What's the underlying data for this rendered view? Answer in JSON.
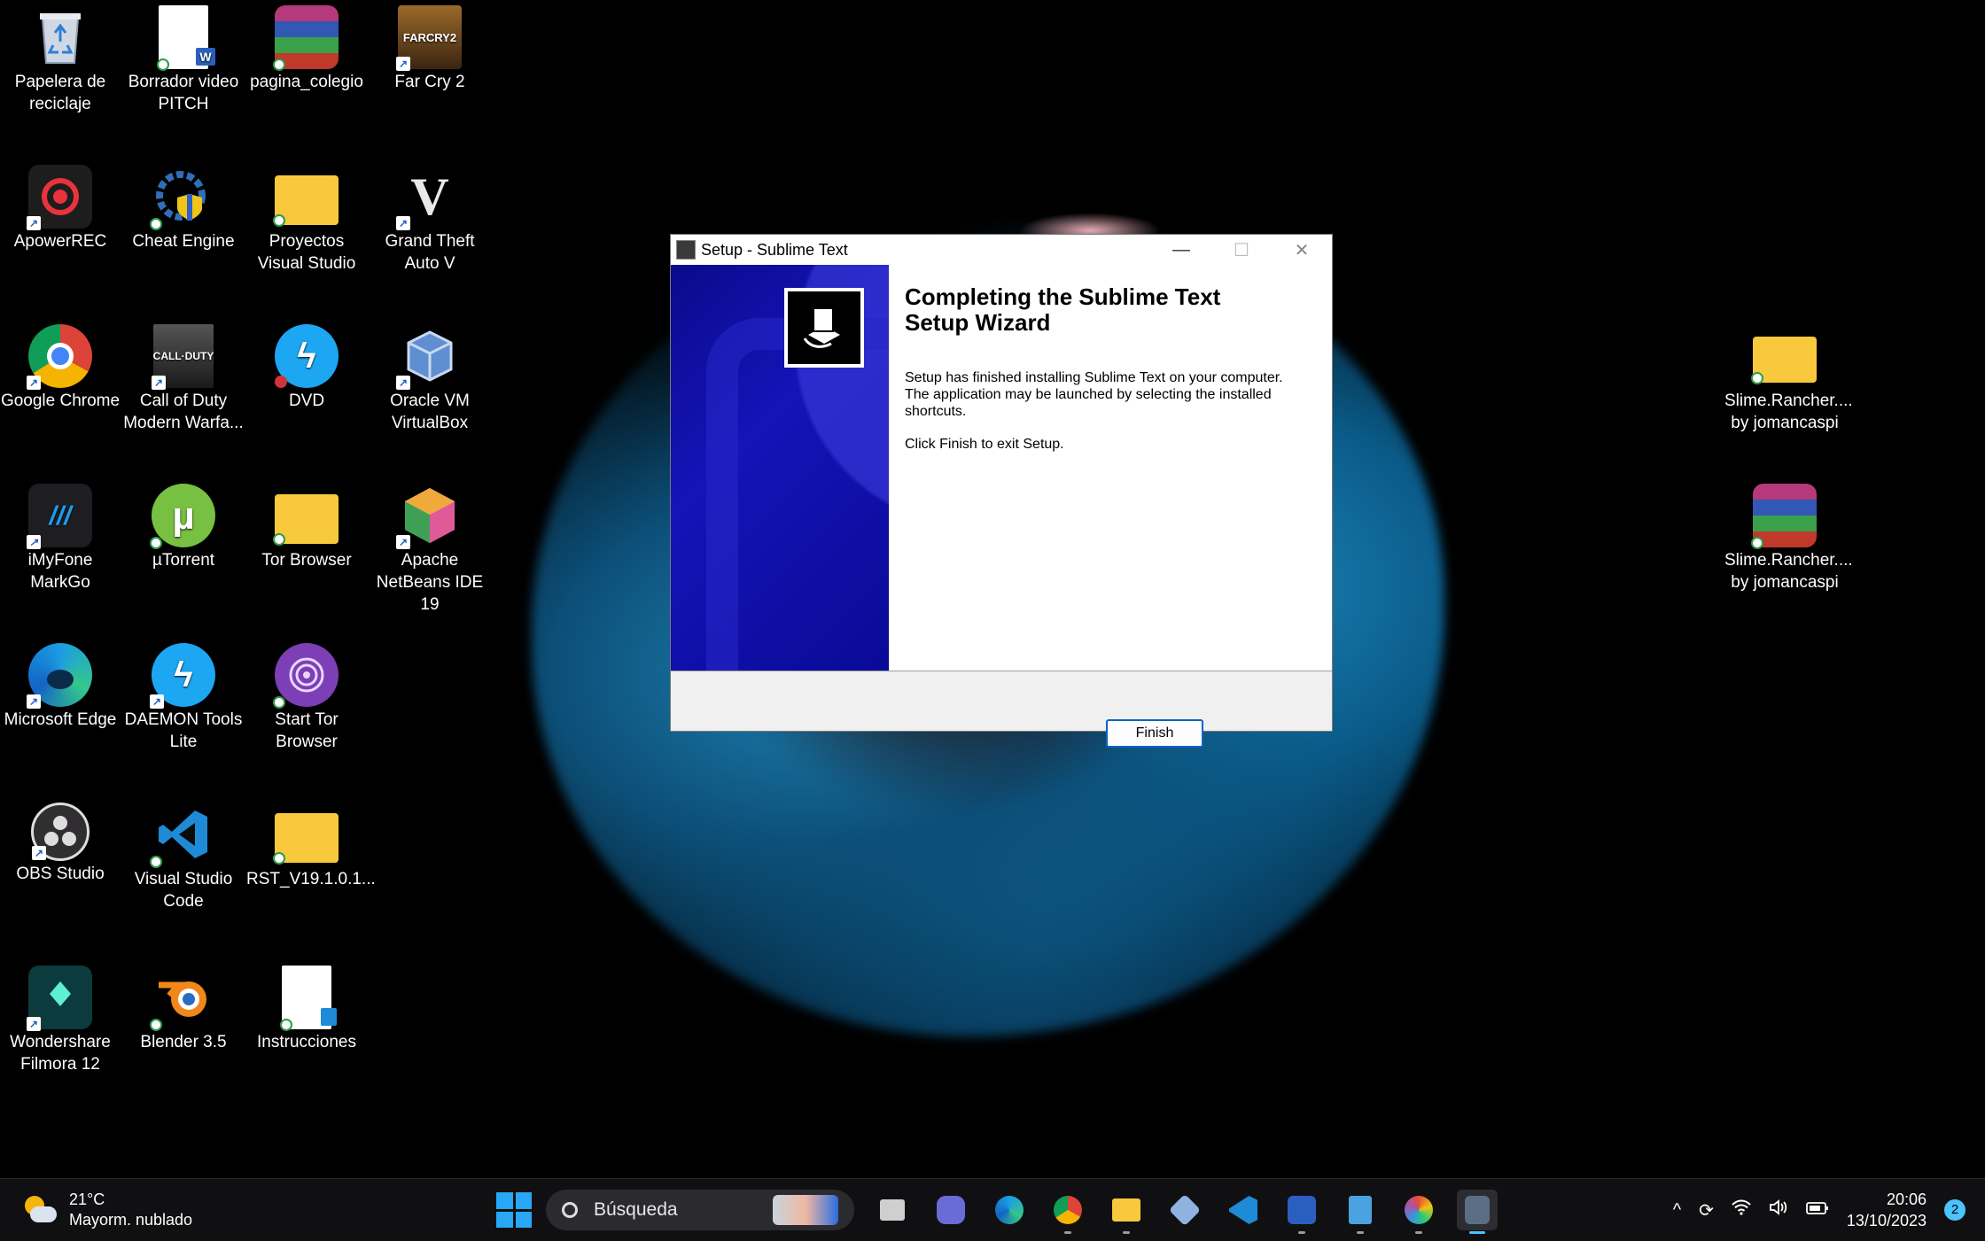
{
  "desktop": {
    "icons": [
      {
        "label": "Papelera de reciclaje",
        "icon": "recycle-bin-icon"
      },
      {
        "label": "Borrador video PITCH",
        "icon": "word-document-icon"
      },
      {
        "label": "pagina_colegio",
        "icon": "winrar-archive-icon"
      },
      {
        "label": "Far Cry 2",
        "icon": "far-cry-2-icon"
      },
      {
        "label": "ApowerREC",
        "icon": "apowerrec-icon"
      },
      {
        "label": "Cheat Engine",
        "icon": "cheat-engine-icon"
      },
      {
        "label": "Proyectos Visual Studio",
        "icon": "folder-icon"
      },
      {
        "label": "Grand Theft Auto V",
        "icon": "gta-v-icon"
      },
      {
        "label": "Google Chrome",
        "icon": "chrome-icon"
      },
      {
        "label": "Call of Duty Modern Warfa...",
        "icon": "call-of-duty-icon"
      },
      {
        "label": "DVD",
        "icon": "daemon-dvd-icon"
      },
      {
        "label": "Oracle VM VirtualBox",
        "icon": "virtualbox-icon"
      },
      {
        "label": "iMyFone MarkGo",
        "icon": "markgo-icon"
      },
      {
        "label": "µTorrent",
        "icon": "utorrent-icon"
      },
      {
        "label": "Tor Browser",
        "icon": "folder-icon"
      },
      {
        "label": "Apache NetBeans IDE 19",
        "icon": "netbeans-icon"
      },
      {
        "label": "Microsoft Edge",
        "icon": "edge-icon"
      },
      {
        "label": "DAEMON Tools Lite",
        "icon": "daemon-tools-icon"
      },
      {
        "label": "Start Tor Browser",
        "icon": "tor-browser-icon"
      },
      {
        "label": "OBS Studio",
        "icon": "obs-icon"
      },
      {
        "label": "Visual Studio Code",
        "icon": "vscode-icon"
      },
      {
        "label": "RST_V19.1.0.1...",
        "icon": "folder-icon"
      },
      {
        "label": "Wondershare Filmora 12",
        "icon": "filmora-icon"
      },
      {
        "label": "Blender 3.5",
        "icon": "blender-icon"
      },
      {
        "label": "Instrucciones",
        "icon": "notepad-document-icon"
      },
      {
        "label": "Slime.Rancher.... by jomancaspi",
        "icon": "folder-icon"
      },
      {
        "label": "Slime.Rancher.... by jomancaspi",
        "icon": "winrar-archive-icon"
      }
    ]
  },
  "setup_window": {
    "title": "Setup - Sublime Text",
    "heading": "Completing the Sublime Text Setup Wizard",
    "paragraph1": "Setup has finished installing Sublime Text on your computer. The application may be launched by selecting the installed shortcuts.",
    "paragraph2": "Click Finish to exit Setup.",
    "finish_label": "Finish",
    "minimize_glyph": "—",
    "maximize_glyph": "☐",
    "close_glyph": "✕"
  },
  "taskbar": {
    "weather_temp": "21°C",
    "weather_desc": "Mayorm. nublado",
    "search_placeholder": "Búsqueda",
    "apps": [
      "task-view-icon",
      "teams-chat-icon",
      "edge-icon",
      "chrome-icon",
      "file-explorer-icon",
      "virtualbox-icon",
      "vscode-icon",
      "word-icon",
      "notepad-icon",
      "paint-icon",
      "setup-icon"
    ],
    "time": "20:06",
    "date": "13/10/2023",
    "notification_count": "2",
    "tray_chevron": "^"
  },
  "colors": {
    "accent": "#4cc2ff",
    "wizard_side": "#0a0a96",
    "finish_border": "#0a62c7"
  }
}
